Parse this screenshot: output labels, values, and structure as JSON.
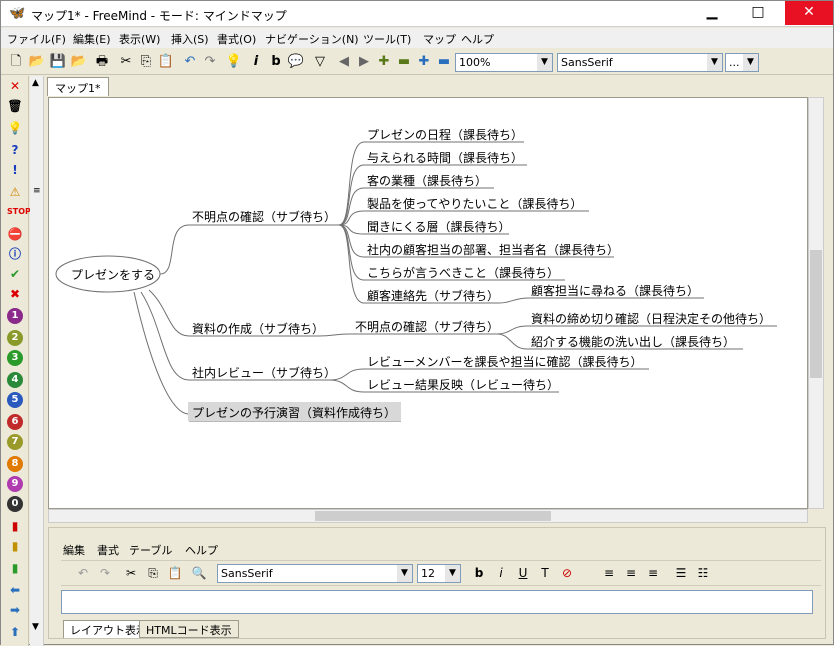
{
  "window": {
    "title": "マップ1* - FreeMind - モード: マインドマップ"
  },
  "menu": [
    "ファイル(F)",
    "編集(E)",
    "表示(W)",
    "挿入(S)",
    "書式(O)",
    "ナビゲーション(N)",
    "ツール(T)",
    "マップ",
    "ヘルプ"
  ],
  "toolbar": {
    "zoom": "100%",
    "font": "SansSerif",
    "size": "..."
  },
  "tab": "マップ1*",
  "map": {
    "root": "プレゼンをする",
    "nodes": [
      "不明点の確認（サブ待ち）",
      "プレゼンの日程（課長待ち）",
      "与えられる時間（課長待ち）",
      "客の業種（課長待ち）",
      "製品を使ってやりたいこと（課長待ち）",
      "聞きにくる層（課長待ち）",
      "社内の顧客担当の部署、担当者名（課長待ち）",
      "こちらが言うべきこと（課長待ち）",
      "顧客連絡先（サブ待ち）",
      "顧客担当に尋ねる（課長待ち）",
      "資料の作成（サブ待ち）",
      "不明点の確認（サブ待ち）",
      "資料の締め切り確認（日程決定その他待ち）",
      "紹介する機能の洗い出し（課長待ち）",
      "社内レビュー（サブ待ち）",
      "レビューメンバーを課長や担当に確認（課長待ち）",
      "レビュー結果反映（レビュー待ち）",
      "プレゼンの予行演習（資料作成待ち）"
    ]
  },
  "notes": {
    "menu": [
      "編集",
      "書式",
      "テーブル",
      "ヘルプ"
    ],
    "font": "SansSerif",
    "size": "12",
    "tabs": [
      "レイアウト表示",
      "HTMLコード表示"
    ]
  }
}
